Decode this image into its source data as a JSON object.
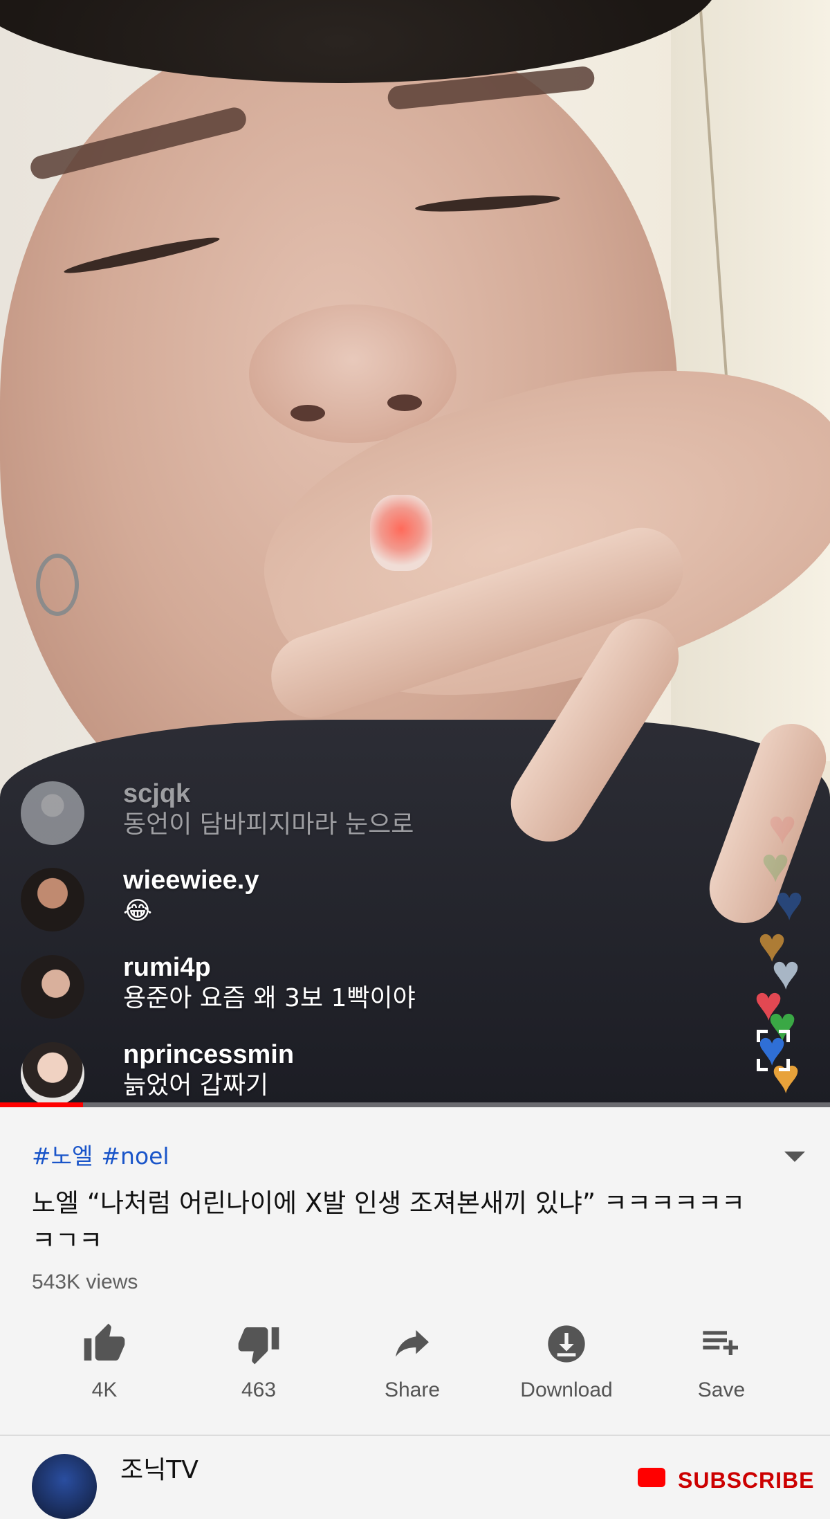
{
  "video": {
    "progress": 0.1,
    "comments": [
      {
        "user": "scjqk",
        "message": "동언이 담바피지마라 눈으로"
      },
      {
        "user": "wieewiee.y",
        "message": "😂"
      },
      {
        "user": "rumi4p",
        "message": "용준아 요즘 왜 3보 1빡이야"
      },
      {
        "user": "nprincessmin",
        "message": "늙었어 갑짜기"
      }
    ],
    "heart_colors": [
      "#e24852",
      "#3aa845",
      "#2f6fd6",
      "#e8a23a",
      "#b7c7d6"
    ],
    "fullscreen_icon": "fullscreen-icon"
  },
  "info": {
    "hashtags": [
      "#노엘",
      "#noel"
    ],
    "title": "노엘 “나처럼 어린나이에 X발 인생 조져본새끼 있냐” ㅋㅋㅋㅋㅋㅋ ㅋㄱㅋ",
    "views": "543K views"
  },
  "actions": [
    {
      "icon": "thumb-up-icon",
      "label": "4K"
    },
    {
      "icon": "thumb-down-icon",
      "label": "463"
    },
    {
      "icon": "share-icon",
      "label": "Share"
    },
    {
      "icon": "download-icon",
      "label": "Download"
    },
    {
      "icon": "save-playlist-icon",
      "label": "Save"
    }
  ],
  "channel": {
    "name": "조닉TV",
    "subscribe_label": "SUBSCRIBE"
  }
}
